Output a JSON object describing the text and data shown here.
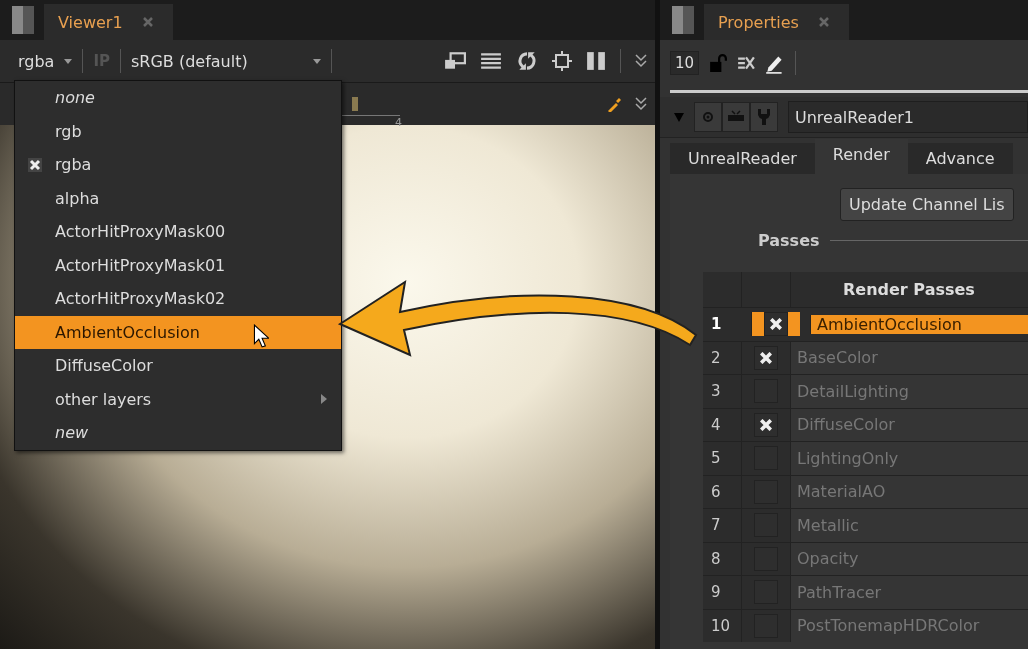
{
  "viewer": {
    "tab_title": "Viewer1",
    "channel_select": "rgba",
    "ip_button": {
      "label": "IP",
      "disabled": true
    },
    "colorspace_select": "sRGB (default)",
    "ruler_label": "4",
    "layer_menu": [
      {
        "label": "none",
        "kind": "special",
        "checked": false,
        "selected": false
      },
      {
        "label": "rgb",
        "kind": "layer",
        "checked": false,
        "selected": false
      },
      {
        "label": "rgba",
        "kind": "layer",
        "checked": true,
        "selected": false
      },
      {
        "label": "alpha",
        "kind": "layer",
        "checked": false,
        "selected": false
      },
      {
        "label": "ActorHitProxyMask00",
        "kind": "layer",
        "checked": false,
        "selected": false
      },
      {
        "label": "ActorHitProxyMask01",
        "kind": "layer",
        "checked": false,
        "selected": false
      },
      {
        "label": "ActorHitProxyMask02",
        "kind": "layer",
        "checked": false,
        "selected": false
      },
      {
        "label": "AmbientOcclusion",
        "kind": "layer",
        "checked": false,
        "selected": true
      },
      {
        "label": "DiffuseColor",
        "kind": "layer",
        "checked": false,
        "selected": false
      },
      {
        "label": "other layers",
        "kind": "submenu",
        "checked": false,
        "selected": false
      },
      {
        "label": "new",
        "kind": "special",
        "checked": false,
        "selected": false
      }
    ]
  },
  "properties": {
    "tab_title": "Properties",
    "max_panels": "10",
    "node_name": "UnrealReader1",
    "tabs": [
      {
        "label": "UnrealReader",
        "selected": false
      },
      {
        "label": "Render",
        "selected": true
      },
      {
        "label": "Advance",
        "selected": false
      }
    ],
    "update_button": "Update Channel Lis",
    "section_label": "Passes",
    "table_header": "Render Passes",
    "rows": [
      {
        "number": "1",
        "checked": true,
        "name": "AmbientOcclusion",
        "selected": true
      },
      {
        "number": "2",
        "checked": true,
        "name": "BaseColor",
        "selected": false
      },
      {
        "number": "3",
        "checked": false,
        "name": "DetailLighting",
        "selected": false
      },
      {
        "number": "4",
        "checked": true,
        "name": "DiffuseColor",
        "selected": false
      },
      {
        "number": "5",
        "checked": false,
        "name": "LightingOnly",
        "selected": false
      },
      {
        "number": "6",
        "checked": false,
        "name": "MaterialAO",
        "selected": false
      },
      {
        "number": "7",
        "checked": false,
        "name": "Metallic",
        "selected": false
      },
      {
        "number": "8",
        "checked": false,
        "name": "Opacity",
        "selected": false
      },
      {
        "number": "9",
        "checked": false,
        "name": "PathTracer",
        "selected": false
      },
      {
        "number": "10",
        "checked": false,
        "name": "PostTonemapHDRColor",
        "selected": false
      }
    ]
  }
}
